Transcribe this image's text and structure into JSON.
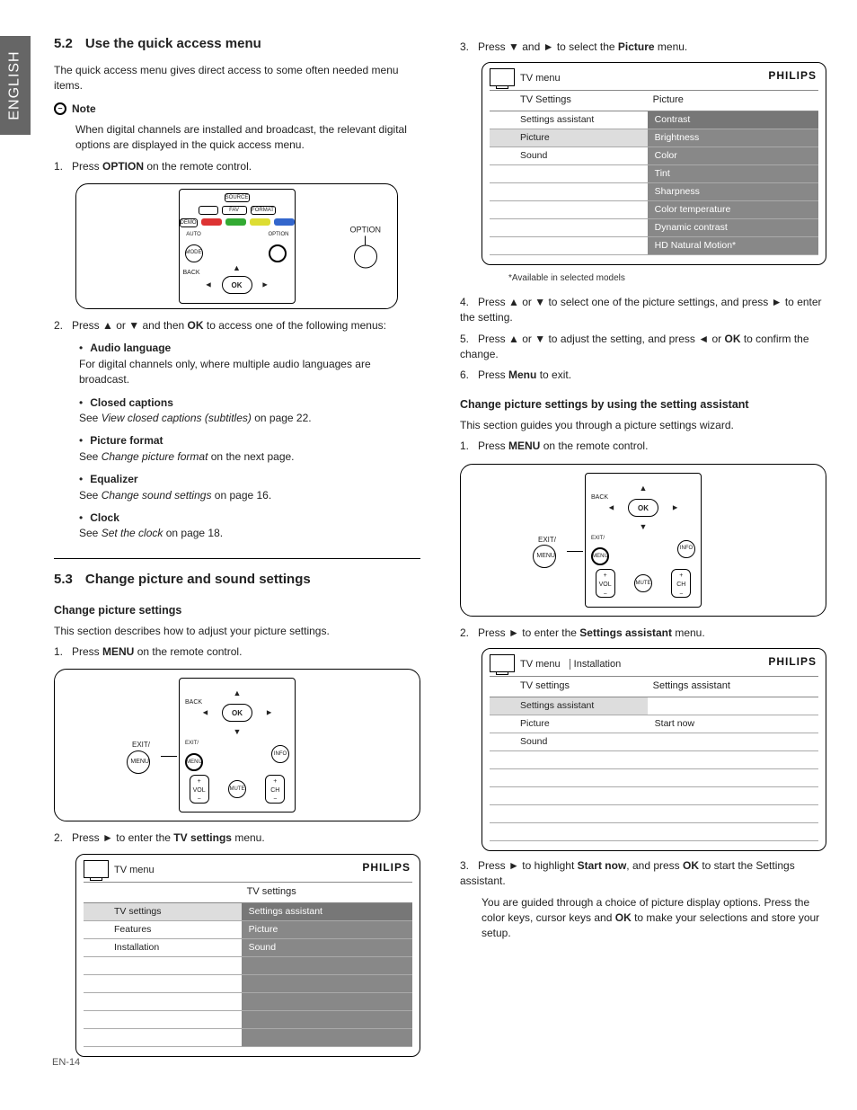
{
  "language_tab": "ENGLISH",
  "page_number": "EN-14",
  "left": {
    "sec52_num": "5.2",
    "sec52_title": "Use the quick access menu",
    "sec52_intro": "The quick access menu gives direct access to some often needed menu items.",
    "note_label": "Note",
    "note_text": "When digital channels are installed and broadcast, the relevant digital options are displayed in the quick access menu.",
    "step1_pre": "Press ",
    "step1_bold": "OPTION",
    "step1_post": " on the remote control.",
    "remote1": {
      "top_btn": "SOURCE",
      "mid_left": "FAV",
      "mid_right": "FORMAT",
      "demo": "DEMO",
      "auto": "AUTO",
      "mode": "MODE",
      "option_cap": "OPTION",
      "back": "BACK",
      "ok": "OK",
      "ext_label": "OPTION"
    },
    "step2_pre": "Press ",
    "step2_mid": " or ",
    "step2_mid2": " and then ",
    "step2_ok": "OK",
    "step2_post": " to access one of the following menus:",
    "bullets": [
      {
        "title": "Audio language",
        "line1": "For digital channels only, where multiple audio languages are broadcast."
      },
      {
        "title": "Closed captions",
        "see": "See ",
        "ital": "View closed captions (subtitles)",
        "post": " on page 22."
      },
      {
        "title": "Picture format",
        "see": "See ",
        "ital": "Change picture format",
        "post": " on the next page."
      },
      {
        "title": "Equalizer",
        "see": "See ",
        "ital": "Change sound settings",
        "post": " on page 16."
      },
      {
        "title": "Clock",
        "see": "See ",
        "ital": "Set the clock",
        "post": " on page 18."
      }
    ],
    "sec53_num": "5.3",
    "sec53_title": "Change picture and sound settings",
    "sub_cps": "Change picture settings",
    "cps_intro": "This section describes how to adjust your picture settings.",
    "cps_step1_pre": "Press ",
    "cps_step1_bold": "MENU",
    "cps_step1_post": " on the remote control.",
    "remote2": {
      "ok": "OK",
      "back": "BACK",
      "exit": "EXIT/",
      "menu": "MENU",
      "info": "INFO",
      "vol": "VOL",
      "mute": "MUTE",
      "ch": "CH"
    },
    "cps_step2_pre": "Press ",
    "cps_step2_mid": " to enter the ",
    "cps_step2_bold": "TV settings",
    "cps_step2_post": " menu.",
    "menu2": {
      "brand": "PHILIPS",
      "crumb": "TV menu",
      "headerR": "TV settings",
      "left": [
        "TV settings",
        "Features",
        "Installation",
        "",
        "",
        "",
        "",
        ""
      ],
      "right": [
        "Settings assistant",
        "Picture",
        "Sound",
        "",
        "",
        "",
        "",
        ""
      ]
    }
  },
  "right": {
    "step3_pre": "Press ",
    "step3_mid": " and ",
    "step3_mid2": " to select the ",
    "step3_bold": "Picture",
    "step3_post": " menu.",
    "menu3": {
      "brand": "PHILIPS",
      "crumb": "TV menu",
      "headerL": "TV Settings",
      "headerR": "Picture",
      "left": [
        "Settings assistant",
        "Picture",
        "Sound",
        "",
        "",
        "",
        "",
        ""
      ],
      "right": [
        "Contrast",
        "Brightness",
        "Color",
        "Tint",
        "Sharpness",
        "Color temperature",
        "Dynamic contrast",
        "HD Natural Motion*"
      ]
    },
    "footnote": "*Available in selected models",
    "step4_pre": "Press ",
    "step4_mid": " or ",
    "step4_mid2": " to select one of the picture settings, and press ",
    "step4_post": " to enter the setting.",
    "step5_pre": "Press ",
    "step5_mid": " or ",
    "step5_mid2": " to adjust the setting, and press ",
    "step5_mid3": " or ",
    "step5_ok": "OK",
    "step5_post": " to confirm the change.",
    "step6_pre": "Press ",
    "step6_bold": "Menu",
    "step6_post": " to exit.",
    "sub_sa": "Change picture settings by using the setting assistant",
    "sa_intro": "This section guides you through a picture settings wizard.",
    "sa_step1_pre": "Press ",
    "sa_step1_bold": "MENU",
    "sa_step1_post": " on the remote control.",
    "sa_step2_pre": "Press ",
    "sa_step2_mid": " to enter the ",
    "sa_step2_bold": "Settings assistant",
    "sa_step2_post": " menu.",
    "menu4": {
      "brand": "PHILIPS",
      "crumb1": "TV menu",
      "crumb2": "Installation",
      "headerL": "TV settings",
      "headerR": "Settings assistant",
      "left": [
        "Settings assistant",
        "Picture",
        "Sound",
        "",
        "",
        "",
        "",
        ""
      ],
      "right": [
        "",
        "Start now",
        "",
        "",
        "",
        "",
        "",
        ""
      ]
    },
    "sa_step3_pre": "Press ",
    "sa_step3_mid": " to highlight ",
    "sa_step3_bold": "Start now",
    "sa_step3_mid2": ", and press ",
    "sa_step3_ok": "OK",
    "sa_step3_post": " to start the Settings assistant.",
    "sa_para_pre": "You are guided through a choice of picture display options.  Press the color keys, cursor keys and ",
    "sa_para_ok": "OK",
    "sa_para_post": " to make your selections and store your setup."
  },
  "arrows": {
    "up": "▲",
    "down": "▼",
    "left": "◄",
    "right": "►"
  }
}
